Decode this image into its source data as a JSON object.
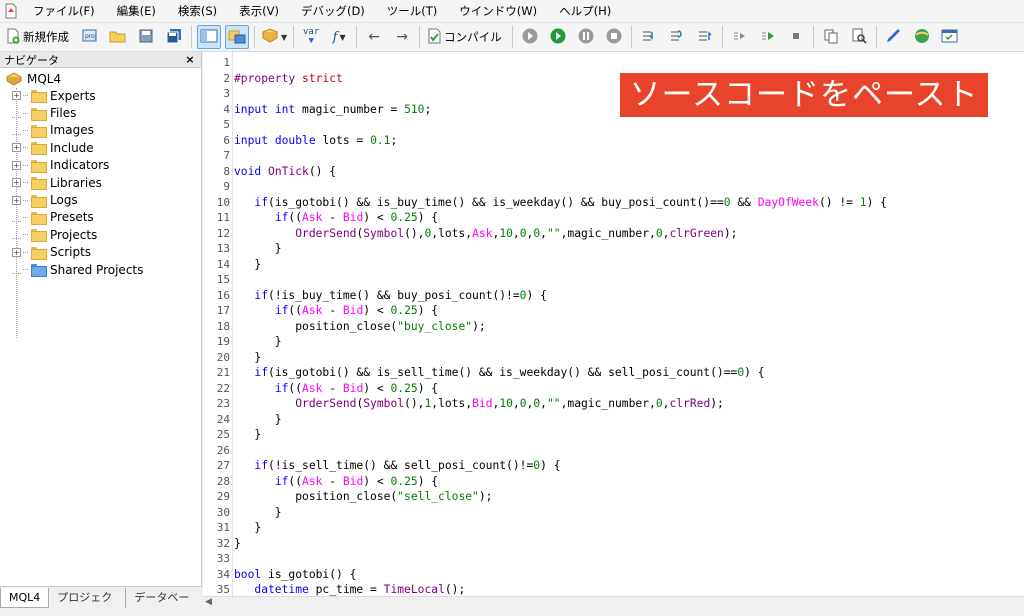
{
  "menu": [
    "ファイル(F)",
    "編集(E)",
    "検索(S)",
    "表示(V)",
    "デバッグ(D)",
    "ツール(T)",
    "ウインドウ(W)",
    "ヘルプ(H)"
  ],
  "toolbar": {
    "new_label": "新規作成",
    "compile_label": "コンパイル",
    "var_label": "var"
  },
  "navigator": {
    "title": "ナビゲータ",
    "close": "×",
    "root": "MQL4",
    "items": [
      {
        "label": "Experts",
        "expandable": true
      },
      {
        "label": "Files",
        "expandable": false
      },
      {
        "label": "Images",
        "expandable": false
      },
      {
        "label": "Include",
        "expandable": true
      },
      {
        "label": "Indicators",
        "expandable": true
      },
      {
        "label": "Libraries",
        "expandable": true
      },
      {
        "label": "Logs",
        "expandable": true
      },
      {
        "label": "Presets",
        "expandable": false
      },
      {
        "label": "Projects",
        "expandable": false
      },
      {
        "label": "Scripts",
        "expandable": true
      },
      {
        "label": "Shared Projects",
        "expandable": false
      }
    ],
    "tabs": [
      "MQL4",
      "プロジェクト",
      "データベース"
    ]
  },
  "banner": "ソースコードをペースト",
  "code_lines": [
    "1",
    "2",
    "3",
    "4",
    "5",
    "6",
    "7",
    "8",
    "9",
    "10",
    "11",
    "12",
    "13",
    "14",
    "15",
    "16",
    "17",
    "18",
    "19",
    "20",
    "21",
    "22",
    "23",
    "24",
    "25",
    "26",
    "27",
    "28",
    "29",
    "30",
    "31",
    "32",
    "33",
    "34",
    "35"
  ],
  "code": [
    "",
    "#property strict",
    "",
    "input int magic_number = 510;",
    "",
    "input double lots = 0.1;",
    "",
    "void OnTick() {",
    "",
    "   if(is_gotobi() && is_buy_time() && is_weekday() && buy_posi_count()==0 && DayOfWeek() != 1) {",
    "      if((Ask - Bid) < 0.25) {",
    "         OrderSend(Symbol(),0,lots,Ask,10,0,0,\"\",magic_number,0,clrGreen);",
    "      }",
    "   }",
    "",
    "   if(!is_buy_time() && buy_posi_count()!=0) {",
    "      if((Ask - Bid) < 0.25) {",
    "         position_close(\"buy_close\");",
    "      }",
    "   }",
    "   if(is_gotobi() && is_sell_time() && is_weekday() && sell_posi_count()==0) {",
    "      if((Ask - Bid) < 0.25) {",
    "         OrderSend(Symbol(),1,lots,Bid,10,0,0,\"\",magic_number,0,clrRed);",
    "      }",
    "   }",
    "",
    "   if(!is_sell_time() && sell_posi_count()!=0) {",
    "      if((Ask - Bid) < 0.25) {",
    "         position_close(\"sell_close\");",
    "      }",
    "   }",
    "}",
    "",
    "bool is_gotobi() {",
    "   datetime pc_time = TimeLocal();"
  ]
}
